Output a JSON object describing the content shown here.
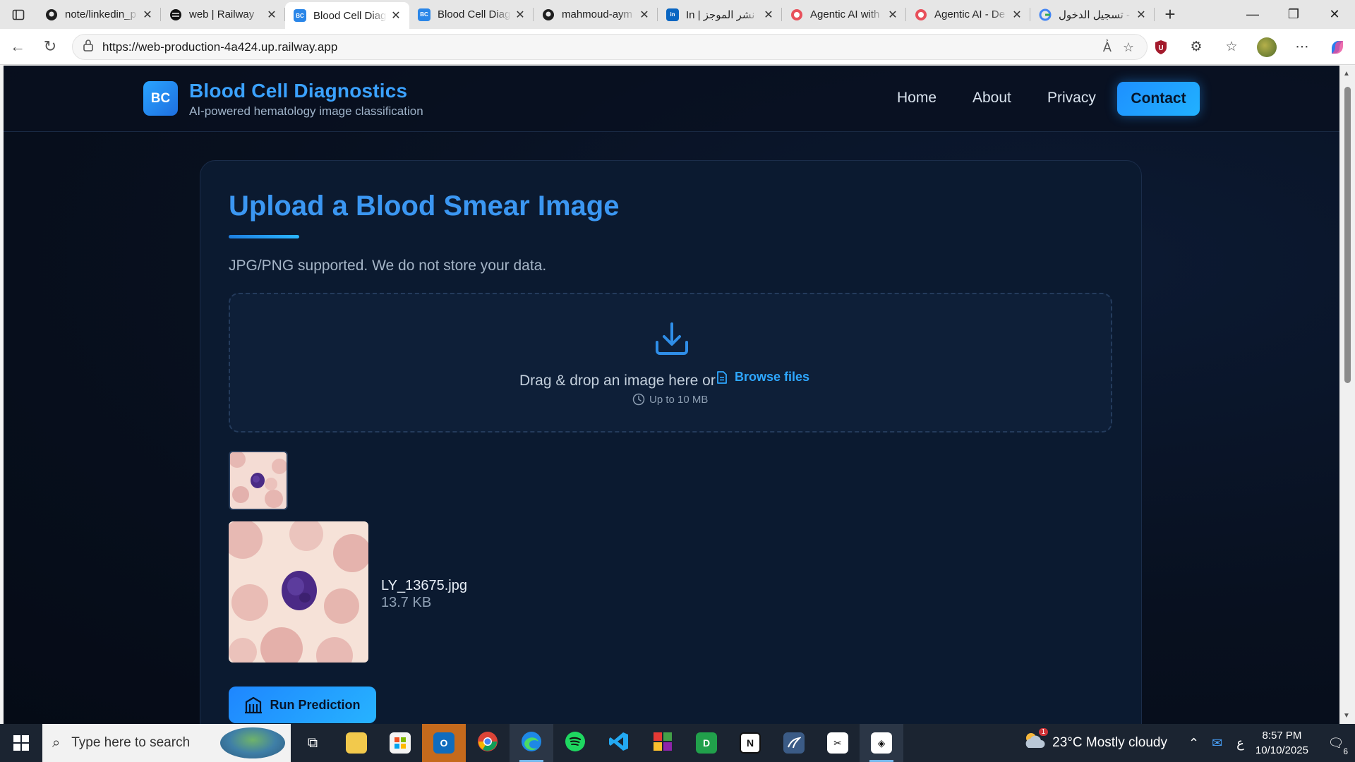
{
  "browser": {
    "tabs": [
      {
        "label": "note/linkedin_p",
        "icon": "github-icon",
        "active": false
      },
      {
        "label": "web | Railway",
        "icon": "railway-icon",
        "active": false
      },
      {
        "label": "Blood Cell Diag",
        "icon": "bc-favicon",
        "active": true
      },
      {
        "label": "Blood Cell Diag",
        "icon": "bc-favicon",
        "active": false
      },
      {
        "label": "mahmoud-aym",
        "icon": "github-icon",
        "active": false
      },
      {
        "label": "In | نشر الموجز",
        "icon": "linkedin-icon",
        "active": false
      },
      {
        "label": "Agentic AI with",
        "icon": "red-circle-icon",
        "active": false
      },
      {
        "label": "Agentic AI - De",
        "icon": "red-circle-icon",
        "active": false
      },
      {
        "label": "تسجيل الدخول -",
        "icon": "google-icon",
        "active": false
      }
    ],
    "favicon_text": "BC",
    "url": "https://web-production-4a424.up.railway.app"
  },
  "site": {
    "logo_text": "BC",
    "title": "Blood Cell Diagnostics",
    "subtitle": "AI-powered hematology image classification",
    "nav": {
      "home": "Home",
      "about": "About",
      "privacy": "Privacy",
      "contact": "Contact"
    }
  },
  "upload": {
    "heading": "Upload a Blood Smear Image",
    "note": "JPG/PNG supported. We do not store your data.",
    "drop_text": "Drag & drop an image here or",
    "browse_label": "Browse files",
    "limit": "Up to 10 MB",
    "file_name": "LY_13675.jpg",
    "file_size": "13.7 KB",
    "run_label": "Run Prediction"
  },
  "taskbar": {
    "search_placeholder": "Type here to search",
    "weather": "23°C  Mostly cloudy",
    "time": "8:57 PM",
    "date": "10/10/2025",
    "lang": "ع",
    "notifications": "6",
    "weather_badge": "1"
  },
  "colors": {
    "accent": "#2ea7ff",
    "heading": "#3b97f2",
    "page_bg": "#08101f",
    "card_bg": "#0b1a30"
  }
}
